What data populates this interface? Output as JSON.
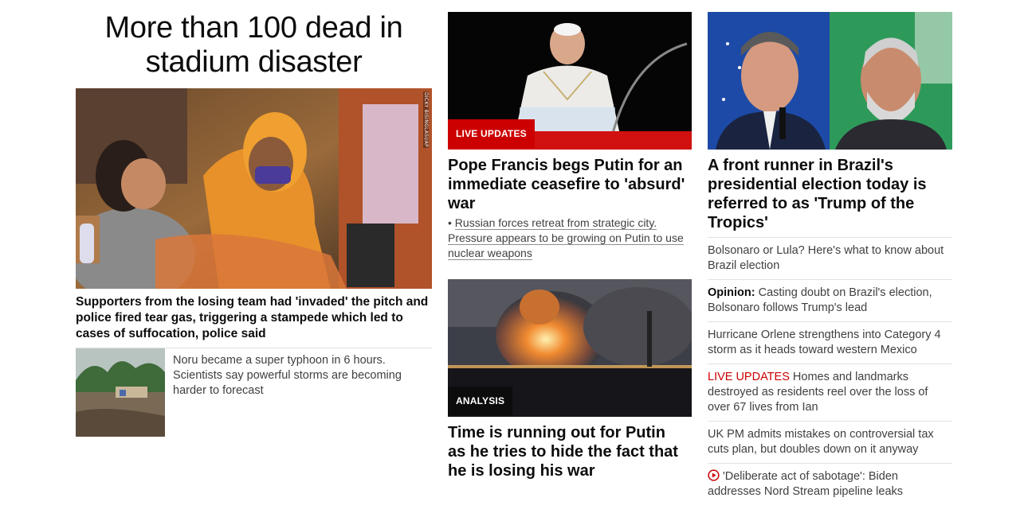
{
  "col1": {
    "headline": "More than 100 dead in stadium disaster",
    "hero_credit": "DICKY BISINGLASI/AP",
    "hero_caption": "Supporters from the losing team had 'invaded' the pitch and police fired tear gas, triggering a stampede which led to cases of suffocation, police said",
    "small_story": "Noru became a super typhoon in 6 hours. Scientists say powerful storms are becoming harder to forecast"
  },
  "col2": {
    "card1": {
      "badge": "LIVE UPDATES",
      "title": "Pope Francis begs Putin for an immediate ceasefire to 'absurd' war",
      "bullet_prefix": "•",
      "bullet": "Russian forces retreat from strategic city. Pressure appears to be growing on Putin to use nuclear weapons"
    },
    "card2": {
      "badge": "ANALYSIS",
      "title": "Time is running out for Putin as he tries to hide the fact that he is losing his war"
    }
  },
  "col3": {
    "title": "A front runner in Brazil's presidential election today is referred to as 'Trump of the Tropics'",
    "items": [
      {
        "prefix": "",
        "text": "Bolsonaro or Lula? Here's what to know about Brazil election"
      },
      {
        "prefix": "Opinion:",
        "text": " Casting doubt on Brazil's election, Bolsonaro follows Trump's lead"
      },
      {
        "prefix": "",
        "text": "Hurricane Orlene strengthens into Category 4 storm as it heads toward western Mexico"
      },
      {
        "prefix": "LIVE UPDATES",
        "text": " Homes and landmarks destroyed as residents reel over the loss of over 67 lives from Ian"
      },
      {
        "prefix": "",
        "text": "UK PM admits mistakes on controversial tax cuts plan, but doubles down on it anyway"
      },
      {
        "prefix": "",
        "text": "'Deliberate act of sabotage': Biden addresses Nord Stream pipeline leaks"
      }
    ]
  },
  "colors": {
    "live_red": "#cc0000",
    "text_dark": "#0c0c0c",
    "text_body": "#404040",
    "divider": "#e2e2e2"
  }
}
